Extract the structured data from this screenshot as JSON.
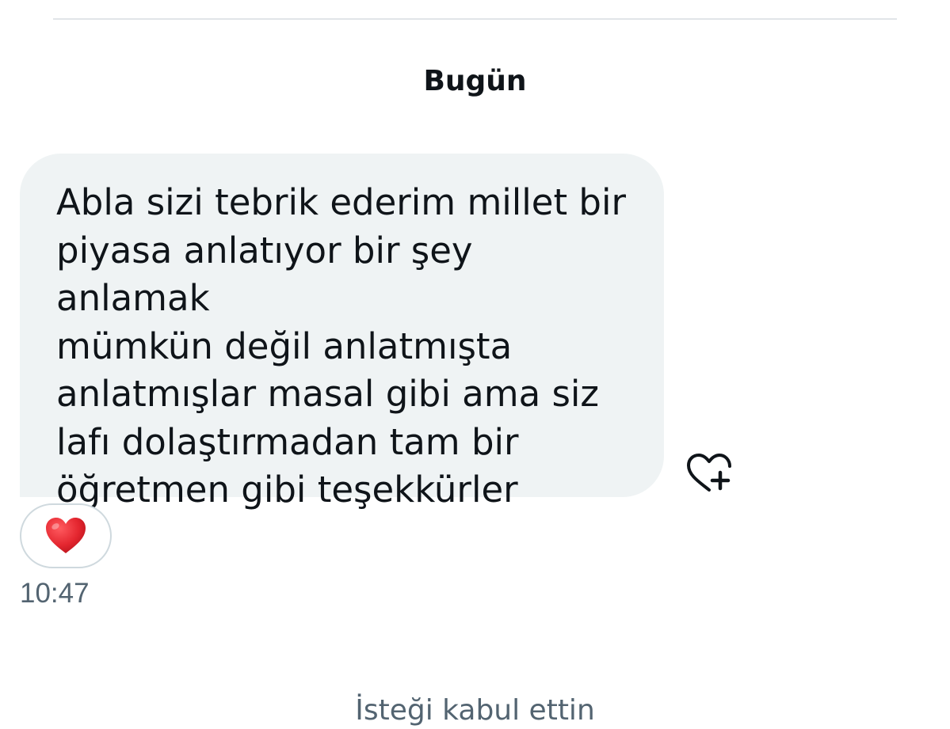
{
  "conversation": {
    "date_separator": "Bugün",
    "message": {
      "text": "Abla sizi tebrik ederim millet bir\npiyasa anlatıyor bir şey anlamak\nmümkün değil anlatmışta\nanlatmışlar masal gibi ama siz\nlafı dolaştırmadan  tam bir\nöğretmen gibi teşekkürler",
      "reaction": "❤️",
      "reaction_icon": "red-heart-emoji",
      "timestamp": "10:47",
      "add_reaction_icon": "heart-plus-icon"
    },
    "bottom_notice": "İsteği kabul ettin"
  },
  "colors": {
    "bubble_background": "#eff3f4",
    "divider": "#e1e5e8",
    "secondary_text": "#536471",
    "primary_text": "#0f1419",
    "heart_red": "#e4262f"
  }
}
